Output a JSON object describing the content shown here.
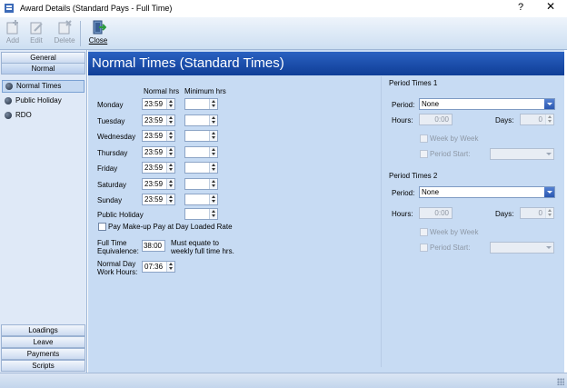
{
  "window": {
    "title": "Award Details (Standard Pays - Full Time)",
    "help_glyph": "?",
    "close_glyph": "✕"
  },
  "toolbar": {
    "add_label": "Add",
    "edit_label": "Edit",
    "delete_label": "Delete",
    "close_label": "Close"
  },
  "nav": {
    "top_headers": [
      "General",
      "Normal"
    ],
    "items": [
      "Normal Times",
      "Public Holiday",
      "RDO"
    ],
    "bottom_headers": [
      "Loadings",
      "Leave",
      "Payments",
      "Scripts"
    ]
  },
  "section": {
    "title": "Normal Times (Standard Times)"
  },
  "times": {
    "col_normal": "Normal hrs",
    "col_minimum": "Minimum hrs",
    "days": [
      {
        "label": "Monday",
        "normal": "23:59",
        "minimum": ""
      },
      {
        "label": "Tuesday",
        "normal": "23:59",
        "minimum": ""
      },
      {
        "label": "Wednesday",
        "normal": "23:59",
        "minimum": ""
      },
      {
        "label": "Thursday",
        "normal": "23:59",
        "minimum": ""
      },
      {
        "label": "Friday",
        "normal": "23:59",
        "minimum": ""
      },
      {
        "label": "Saturday",
        "normal": "23:59",
        "minimum": ""
      },
      {
        "label": "Sunday",
        "normal": "23:59",
        "minimum": ""
      }
    ],
    "public_holiday_label": "Public Holiday",
    "public_holiday_minimum": "",
    "makeup_label": "Pay Make-up Pay at Day Loaded Rate",
    "fte_label_1": "Full Time",
    "fte_label_2": "Equivalence:",
    "fte_value": "38:00",
    "fte_note_1": "Must equate to",
    "fte_note_2": "weekly full time hrs.",
    "ndwh_label_1": "Normal Day",
    "ndwh_label_2": "Work Hours:",
    "ndwh_value": "07:36"
  },
  "period1": {
    "heading": "Period Times 1",
    "period_label": "Period:",
    "period_value": "None",
    "hours_label": "Hours:",
    "hours_value": "0:00",
    "days_label": "Days:",
    "days_value": "0",
    "week_by_week_label": "Week by Week",
    "period_start_label": "Period Start:"
  },
  "period2": {
    "heading": "Period Times 2",
    "period_label": "Period:",
    "period_value": "None",
    "hours_label": "Hours:",
    "hours_value": "0:00",
    "days_label": "Days:",
    "days_value": "0",
    "week_by_week_label": "Week by Week",
    "period_start_label": "Period Start:"
  }
}
